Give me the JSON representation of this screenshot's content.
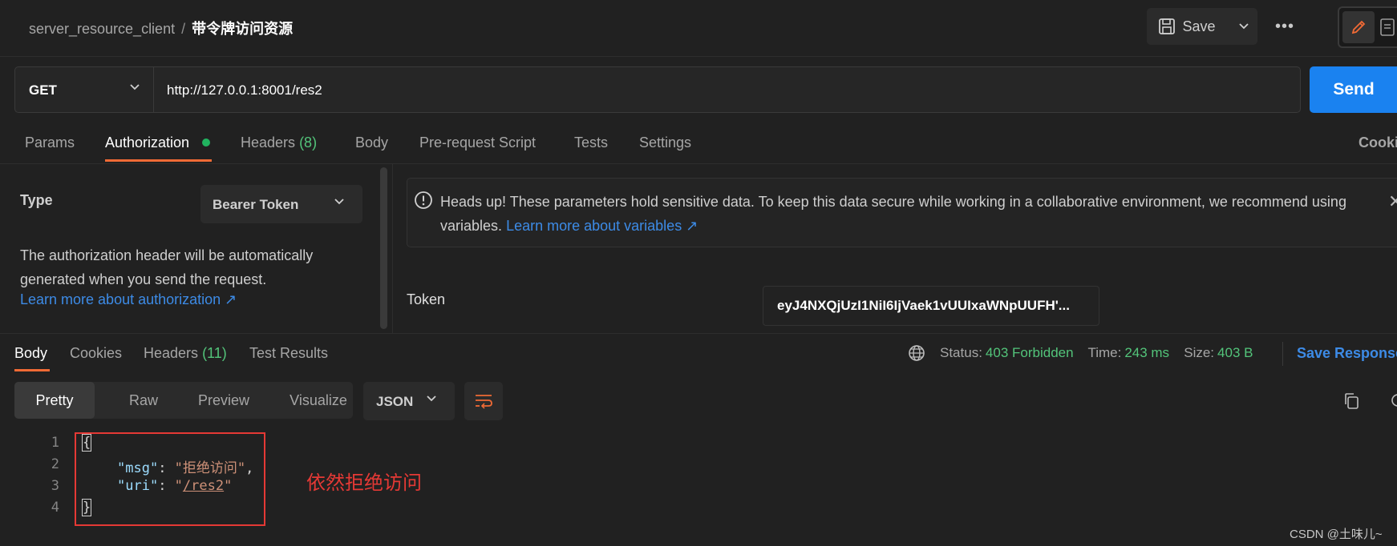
{
  "breadcrumb": {
    "collection": "server_resource_client",
    "separator": "/",
    "request": "带令牌访问资源"
  },
  "toolbar": {
    "save_label": "Save",
    "more_label": "•••"
  },
  "request": {
    "method": "GET",
    "url": "http://127.0.0.1:8001/res2",
    "send_label": "Send"
  },
  "request_tabs": {
    "params": "Params",
    "authorization": "Authorization",
    "headers": "Headers",
    "headers_count": "(8)",
    "body": "Body",
    "pre_request": "Pre-request Script",
    "tests": "Tests",
    "settings": "Settings",
    "cookies": "Cookies"
  },
  "auth": {
    "type_label": "Type",
    "type_value": "Bearer Token",
    "description": "The authorization header will be automatically generated when you send the request.",
    "learn_more": "Learn more about authorization ↗",
    "warning_text": "Heads up! These parameters hold sensitive data. To keep this data secure while working in a collaborative environment, we recommend using variables.",
    "warning_link": "Learn more about variables ↗",
    "token_label": "Token",
    "token_value": "eyJ4NXQjUzI1NiI6IjVaek1vUUIxaWNpUUFH'..."
  },
  "response": {
    "tabs": {
      "body": "Body",
      "cookies": "Cookies",
      "headers": "Headers",
      "headers_count": "(11)",
      "test_results": "Test Results"
    },
    "status_label": "Status:",
    "status_value": "403 Forbidden",
    "time_label": "Time:",
    "time_value": "243 ms",
    "size_label": "Size:",
    "size_value": "403 B",
    "save_response": "Save Response"
  },
  "body_view": {
    "tabs": [
      "Pretty",
      "Raw",
      "Preview",
      "Visualize"
    ],
    "format": "JSON"
  },
  "code": {
    "line_numbers": [
      "1",
      "2",
      "3",
      "4"
    ],
    "open_brace": "{",
    "close_brace": "}",
    "msg_key": "\"msg\"",
    "msg_value": "\"拒绝访问\"",
    "uri_key": "\"uri\"",
    "uri_quote": "\"",
    "uri_path": "/res2"
  },
  "annotation": "依然拒绝访问",
  "watermark": "CSDN @土味儿~",
  "colors": {
    "accent": "#f06a35",
    "send": "#1a82f0",
    "success": "#53c47a",
    "annotation": "#e53935",
    "link": "#3d8be6"
  }
}
